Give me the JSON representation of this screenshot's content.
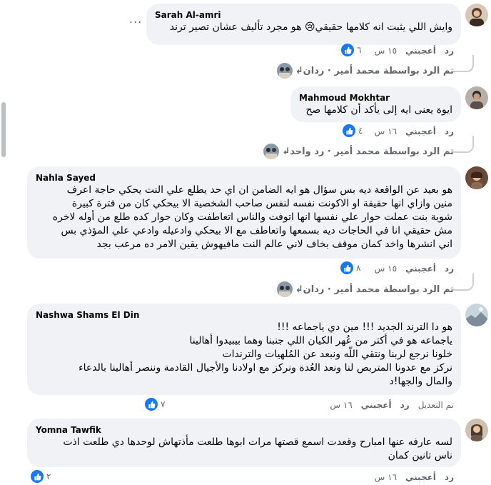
{
  "comments": [
    {
      "author": "Sarah Al-amri",
      "lines": [
        "وايش اللي يثبت انه كلامها حقيقي😢 هو مجرد تأليف عشان تصير ترند"
      ],
      "more_label": "...",
      "time": "١٥ س",
      "like_label": "أعجبني",
      "reply_label": "رد",
      "reactions": "٦",
      "thread_reply": "تم الرد بواسطة محمد أمير · ردان"
    },
    {
      "author": "Mahmoud Mokhtar",
      "lines": [
        "ايوة يعنى ايه إلى يأكد أن كلامها صح"
      ],
      "time": "١٦ س",
      "like_label": "أعجبني",
      "reply_label": "رد",
      "reactions": "٤",
      "thread_reply": "تم الرد بواسطة محمد أمير · رد واحد"
    },
    {
      "author": "Nahla Sayed",
      "lines": [
        "هو بعيد عن الواقعة ديه بس سؤال هو ايه الضامن ان اي حد يطلع علي النت يحكي حاجة اعرف",
        "منين وازاي انها حقيقة او الاكونت نفسه لنفس صاحب الشخصية الا بيحكي كان من فترة كبيرة",
        "شوية بنت عملت حوار علي نفسها انها اتوفت والناس اتعاطفت وكان حوار كده طلع من أوله لاخره",
        "مش حقيقي انا في الحاجات ديه بسمعها واتعاطف مع الا بيحكي وادعيله وادعي علي المؤذي بس",
        "اني انشرها واخد كمان موقف بخاف لاني عالم النت مافيهوش يقين الامر ده مرعب بجد"
      ],
      "time": "١٥ س",
      "like_label": "أعجبني",
      "reply_label": "رد",
      "reactions": "٨",
      "thread_reply": "تم الرد بواسطة محمد أمير · ردان"
    },
    {
      "author": "Nashwa Shams El Din",
      "lines": [
        "هو دا الترند الجديد !!! مين دي ياجماعه !!!",
        "ياجماعه هو في أكتر من عُهر الكيان اللي جنبنا وهما بيبيدوا أهالينا",
        "خلونا نرجع لربنا ونتقي اللّه ونبعد عن المُلهيات والترندات",
        "نركز مع عدونا المتربص لنا ونعد العُدة ونركز مع اولادنا والأجيال القادمة وننصر أهالينا بالدعاء",
        "والمال والجها!د"
      ],
      "time": "١٦ س",
      "like_label": "أعجبني",
      "reply_label": "رد",
      "edited_label": "تم التعديل",
      "reactions": "٧"
    },
    {
      "author": "Yomna Tawfik",
      "lines": [
        "لسه عارفه عنها امبارح وقعدت اسمع قصتها مرات ابوها طلعت مأذتهاش لوحدها دي طلعت اذت",
        "ناس تانين كمان"
      ],
      "time": "١٦ س",
      "like_label": "أعجبني",
      "reply_label": "رد",
      "reactions": "٢"
    }
  ]
}
